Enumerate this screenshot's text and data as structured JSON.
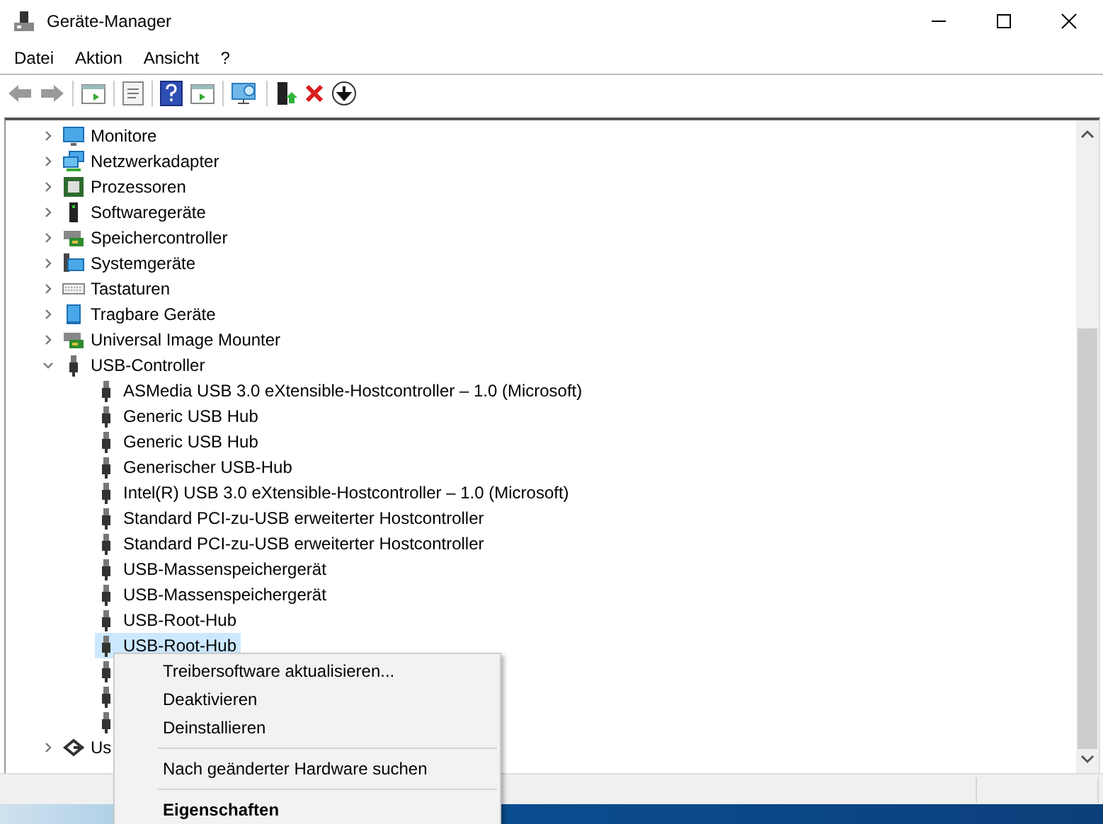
{
  "window": {
    "title": "Geräte-Manager"
  },
  "menu_bar": [
    "Datei",
    "Aktion",
    "Ansicht",
    "?"
  ],
  "tree": [
    {
      "label": "Monitore",
      "kind": "monitor",
      "expanded": false
    },
    {
      "label": "Netzwerkadapter",
      "kind": "network",
      "expanded": false
    },
    {
      "label": "Prozessoren",
      "kind": "cpu",
      "expanded": false
    },
    {
      "label": "Softwaregeräte",
      "kind": "software",
      "expanded": false
    },
    {
      "label": "Speichercontroller",
      "kind": "storage",
      "expanded": false
    },
    {
      "label": "Systemgeräte",
      "kind": "system",
      "expanded": false
    },
    {
      "label": "Tastaturen",
      "kind": "keyboard",
      "expanded": false
    },
    {
      "label": "Tragbare Geräte",
      "kind": "portable",
      "expanded": false
    },
    {
      "label": "Universal Image Mounter",
      "kind": "storage",
      "expanded": false
    },
    {
      "label": "USB-Controller",
      "kind": "usb",
      "expanded": true,
      "children": [
        {
          "label": "ASMedia USB 3.0 eXtensible-Hostcontroller – 1.0 (Microsoft)",
          "selected": false
        },
        {
          "label": "Generic USB Hub",
          "selected": false
        },
        {
          "label": "Generic USB Hub",
          "selected": false
        },
        {
          "label": "Generischer USB-Hub",
          "selected": false
        },
        {
          "label": "Intel(R) USB 3.0 eXtensible-Hostcontroller – 1.0 (Microsoft)",
          "selected": false
        },
        {
          "label": "Standard PCI-zu-USB erweiterter Hostcontroller",
          "selected": false
        },
        {
          "label": "Standard PCI-zu-USB erweiterter Hostcontroller",
          "selected": false
        },
        {
          "label": "USB-Massenspeichergerät",
          "selected": false
        },
        {
          "label": "USB-Massenspeichergerät",
          "selected": false
        },
        {
          "label": "USB-Root-Hub",
          "selected": false
        },
        {
          "label": "USB-Root-Hub",
          "selected": true
        },
        {
          "selected": false
        },
        {
          "selected": false
        },
        {
          "selected": false
        }
      ]
    },
    {
      "label": "Us",
      "kind": "usbdevice",
      "expanded": false
    }
  ],
  "context_menu": [
    {
      "kind": "item",
      "label": "Treibersoftware aktualisieren...",
      "default": false
    },
    {
      "kind": "item",
      "label": "Deaktivieren",
      "default": false
    },
    {
      "kind": "item",
      "label": "Deinstallieren",
      "default": false
    },
    {
      "kind": "separator"
    },
    {
      "kind": "item",
      "label": "Nach geänderter Hardware suchen",
      "default": false
    },
    {
      "kind": "separator"
    },
    {
      "kind": "item",
      "label": "Eigenschaften",
      "default": true
    }
  ]
}
